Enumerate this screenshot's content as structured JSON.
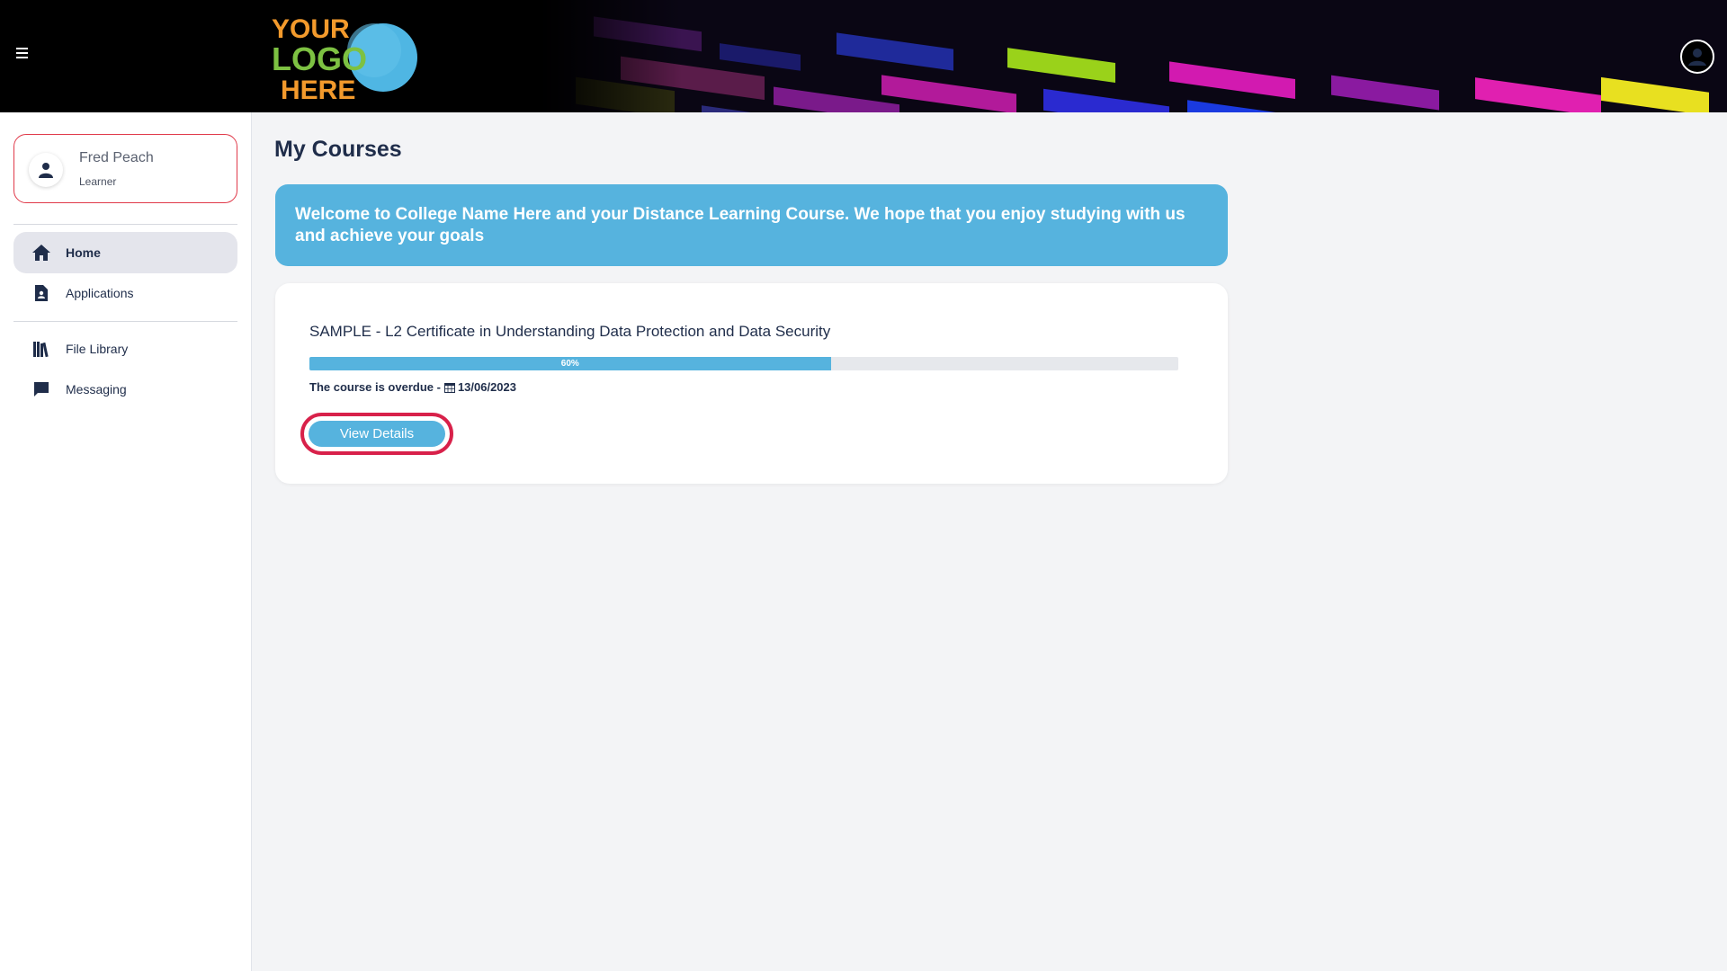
{
  "header": {
    "menu_icon": "hamburger-menu-icon",
    "logo_line1": "YOUR",
    "logo_line2": "LOGO",
    "logo_line3": "HERE",
    "profile_icon": "account-circle-icon"
  },
  "user": {
    "name": "Fred Peach",
    "role": "Learner",
    "icon": "person-icon"
  },
  "sidebar": {
    "items": [
      {
        "label": "Home",
        "icon": "home-icon",
        "active": true
      },
      {
        "label": "Applications",
        "icon": "document-icon",
        "active": false
      },
      {
        "label": "File Library",
        "icon": "library-icon",
        "active": false
      },
      {
        "label": "Messaging",
        "icon": "chat-icon",
        "active": false
      }
    ]
  },
  "main": {
    "title": "My Courses",
    "welcome": "Welcome to College Name Here and your Distance Learning Course. We hope that you enjoy studying with us and achieve your goals"
  },
  "course": {
    "title": "SAMPLE - L2 Certificate in Understanding Data Protection and Data Security",
    "progress_percent": 60,
    "progress_label": "60%",
    "overdue_text": "The course is overdue -",
    "due_date": "13/06/2023",
    "view_button": "View Details"
  },
  "colors": {
    "accent": "#56b3de",
    "highlight": "#d8214a",
    "text": "#1f2d4a"
  }
}
